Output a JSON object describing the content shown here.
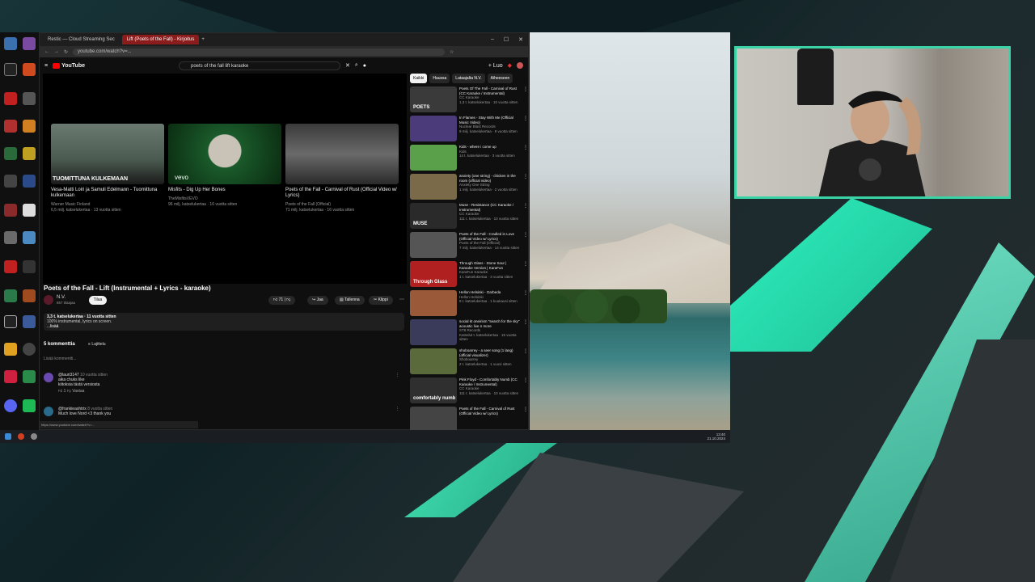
{
  "browser": {
    "tabs": [
      {
        "label": "Restic — Cloud Streaming Sec"
      },
      {
        "label": "Lift (Poets of the Fall) - Kirjoitus"
      }
    ],
    "url": "youtube.com/watch?v=...",
    "window_controls": [
      "–",
      "☐",
      "✕"
    ]
  },
  "youtube": {
    "logo": "YouTube",
    "search_query": "poets of the fall lift karaoke",
    "create_label": "+ Luo",
    "end_cards": [
      {
        "title": "Vesa-Matti Loiri ja Samuli Edelmann - Tuomittuna kulkemaan",
        "channel": "Warner Music Finland",
        "meta": "6,5 milj. katselukertaa · 13 vuotta sitten",
        "overlay": "TUOMITTUNA KULKEMAAN"
      },
      {
        "title": "Misfits - Dig Up Her Bones",
        "channel": "TheMisfitsVEVO",
        "meta": "96 milj. katselukertaa · 16 vuotta sitten",
        "overlay": "vevo"
      },
      {
        "title": "Poets of the Fall - Carnival of Rust (Official Video w/ Lyrics)",
        "channel": "Poets of the Fall (Official)",
        "meta": "71 milj. katselukertaa · 16 vuotta sitten",
        "overlay": ""
      }
    ],
    "video": {
      "title": "Poets of the Fall - Lift (Instrumental + Lyrics - karaoke)",
      "channel": "N.V.",
      "subscribers": "857 tilaajaa",
      "subscribe_label": "Tilaa",
      "likes": "71",
      "share_label": "Jaa",
      "save_label": "Tallenna",
      "clip_label": "Klippi",
      "description_line1": "3,3 t. katselukertaa · 11 vuotta sitten",
      "description_line2": "100% instrumental, lyrics on screen.",
      "description_more": "...lisää"
    },
    "comments": {
      "count_label": "5 kommenttia",
      "sort_label": "Lajittelu",
      "add_placeholder": "Lisää kommentti...",
      "items": [
        {
          "author": "@lauri3147",
          "age": "10 vuotta sitten",
          "text": "aika chuks like",
          "text2": "kiitoksia tästä versiosta",
          "reply": "Vastaa"
        },
        {
          "author": "@frankieashtrix",
          "age": "8 vuotta sitten",
          "text": "Much love Nord <3 thank you",
          "text2": "",
          "reply": ""
        }
      ]
    },
    "chips": [
      "Kaikki",
      "Haussa",
      "Lataajalta N.V.",
      "Aiheeseen"
    ],
    "recommendations": [
      {
        "title": "Poets Of The Fall - Carnival of Rust (CC Karaoke / Instrumental)",
        "channel": "CC Karaoke",
        "meta": "1,3 t. katselukertaa · 10 vuotta sitten",
        "thumb": "#3a3a3a",
        "label": "POETS"
      },
      {
        "title": "In Flames - Stay With Me (Official Music Video)",
        "channel": "Nuclear Blast Records",
        "meta": "9 milj. katselukertaa · 9 vuotta sitten",
        "thumb": "#4b3b7a",
        "label": ""
      },
      {
        "title": "Kids - where i come up",
        "channel": "Kids",
        "meta": "14 t. katselukertaa · 3 vuotta sitten",
        "thumb": "#5aa04a",
        "label": ""
      },
      {
        "title": "anxiety (one string) - chicken in the room (official video)",
        "channel": "Anxiety One String",
        "meta": "1 milj. katselukertaa · 2 vuotta sitten",
        "thumb": "#7a6a4a",
        "label": ""
      },
      {
        "title": "Muse - Resistance (CC Karaoke / Instrumental)",
        "channel": "CC Karaoke",
        "meta": "111 t. katselukertaa · 10 vuotta sitten",
        "thumb": "#2a2a2a",
        "label": "MUSE"
      },
      {
        "title": "Poets of the Fall - Cradled in Love (Official Video w/ Lyrics)",
        "channel": "Poets of the Fall (Official)",
        "meta": "7 milj. katselukertaa · 14 vuotta sitten",
        "thumb": "#555555",
        "label": ""
      },
      {
        "title": "Through Glass - Stone Sour | Karaoke Version | KaraFun",
        "channel": "KaraFun Karaoke",
        "meta": "1 t. katselukertaa · 3 vuotta sitten",
        "thumb": "#b02020",
        "label": "Through Glass"
      },
      {
        "title": "Hellon Helsinki - Garbeda",
        "channel": "Hellon Helsinki",
        "meta": "9 t. katselukertaa · 1 kuukausi sitten",
        "thumb": "#9a5a3a",
        "label": ""
      },
      {
        "title": "social kt oneirism \"search for the sky\" acoustic live n more",
        "channel": "ST8 Records",
        "meta": "Katselut t. katselukertaa · 15 vuotta sitten",
        "thumb": "#3a3a5a",
        "label": ""
      },
      {
        "title": "shoboarrey - a seer song (1 lang) (official visualizer)",
        "channel": "Shoboarrey",
        "meta": "2 t. katselukertaa · 1 vuosi sitten",
        "thumb": "#5a6a3a",
        "label": ""
      },
      {
        "title": "Pink Floyd - Comfortably Numb (CC Karaoke / Instrumental)",
        "channel": "CC Karaoke",
        "meta": "111 t. katselukertaa · 10 vuotta sitten",
        "thumb": "#2f2f2f",
        "label": "comfortably numb"
      },
      {
        "title": "Poets of the Fall - Carnival of Rust (Official Video w/ Lyrics)",
        "channel": "",
        "meta": "",
        "thumb": "#444444",
        "label": ""
      }
    ],
    "status_url": "https://www.youtube.com/watch?v=..."
  },
  "taskbar": {
    "time": "13:40",
    "date": "21.10.2024"
  }
}
